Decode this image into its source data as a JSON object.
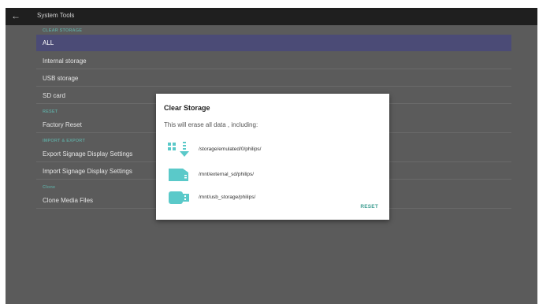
{
  "header": {
    "title": "System Tools"
  },
  "sections": {
    "clear_storage": "CLEAR STORAGE",
    "reset": "RESET",
    "import_export": "IMPORT & EXPORT",
    "clone": "Clone"
  },
  "items": {
    "all": "ALL",
    "internal_storage": "Internal storage",
    "usb_storage": "USB storage",
    "sd_card": "SD card",
    "factory_reset": "Factory Reset",
    "export_settings": "Export Signage Display Settings",
    "import_settings": "Import Signage Display Settings",
    "clone_media": "Clone Media Files"
  },
  "dialog": {
    "title": "Clear Storage",
    "message": "This will erase all data , including:",
    "rows": [
      {
        "icon": "internal-storage-icon",
        "path": "/storage/emulated/0/philips/"
      },
      {
        "icon": "sd-card-icon",
        "path": "/mnt/external_sd/philips/"
      },
      {
        "icon": "usb-drive-icon",
        "path": "/mnt/usb_storage/philips/"
      }
    ],
    "reset_label": "RESET"
  },
  "colors": {
    "accent": "#3f9e92",
    "selected_row": "#4b4b76",
    "background": "#5b5b5b",
    "topbar": "#1f1f1f"
  }
}
